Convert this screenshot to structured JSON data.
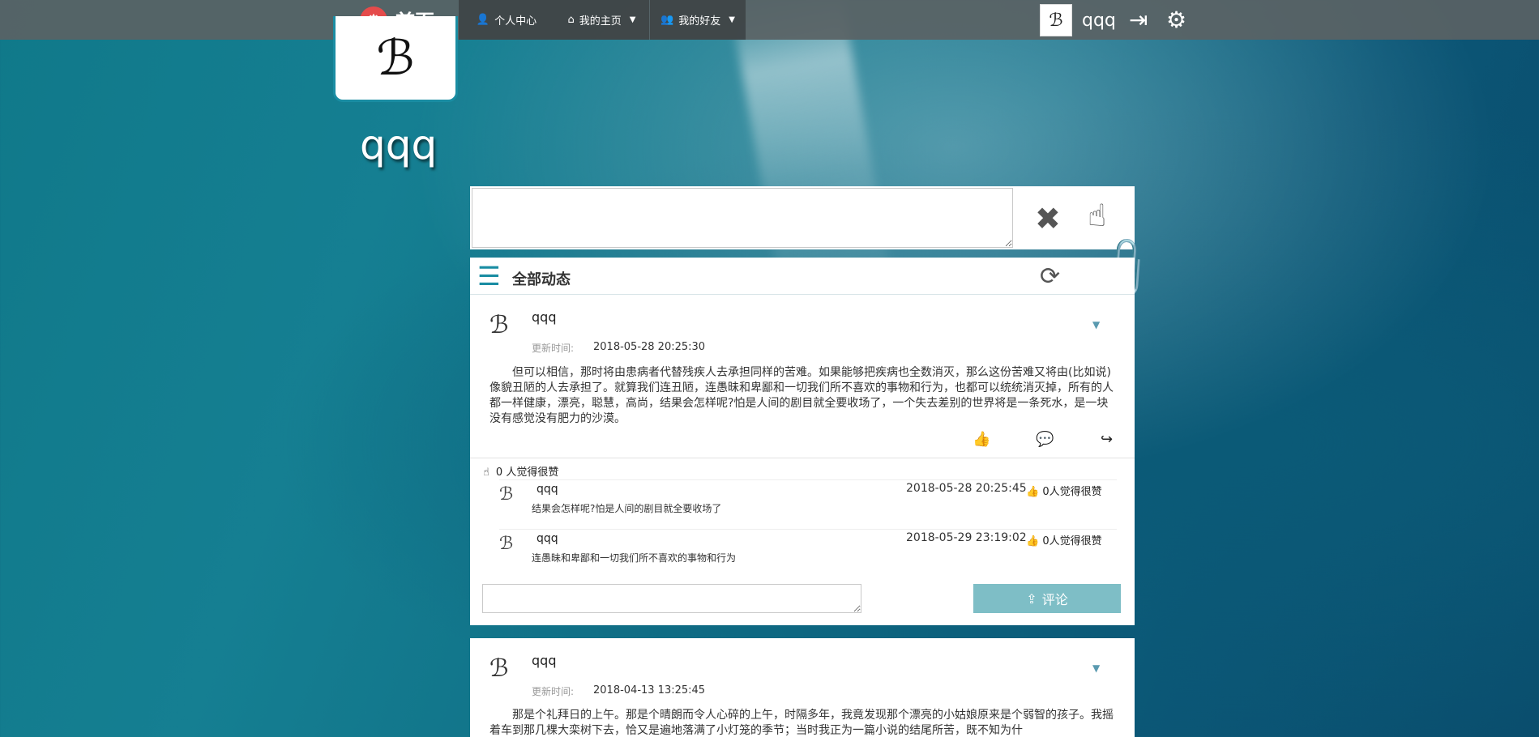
{
  "nav": {
    "brand": "首页",
    "items": [
      {
        "label": "个人中心",
        "icon": "user-icon"
      },
      {
        "label": "我的主页",
        "icon": "home-icon"
      },
      {
        "label": "我的好友",
        "icon": "users-icon"
      }
    ],
    "username": "qqq"
  },
  "profile": {
    "name": "qqq"
  },
  "feed": {
    "title": "全部动态"
  },
  "posts": [
    {
      "user": "qqq",
      "time_label": "更新时间:",
      "time": "2018-05-28 20:25:30",
      "body": "但可以相信，那时将由患病者代替残疾人去承担同样的苦难。如果能够把疾病也全数消灭，那么这份苦难又将由(比如说)像貌丑陋的人去承担了。就算我们连丑陋，连愚昧和卑鄙和一切我们所不喜欢的事物和行为，也都可以统统消灭掉，所有的人都一样健康，漂亮，聪慧，高尚，结果会怎样呢?怕是人间的剧目就全要收场了，一个失去差别的世界将是一条死水，是一块没有感觉没有肥力的沙漠。",
      "likes_text": "0 人觉得很赞",
      "comments": [
        {
          "user": "qqq",
          "time": "2018-05-28 20:25:45",
          "likes": "0人觉得很赞",
          "text": "结果会怎样呢?怕是人间的剧目就全要收场了"
        },
        {
          "user": "qqq",
          "time": "2018-05-29 23:19:02",
          "likes": "0人觉得很赞",
          "text": "连愚昧和卑鄙和一切我们所不喜欢的事物和行为"
        }
      ],
      "comment_button": "评论"
    },
    {
      "user": "qqq",
      "time_label": "更新时间:",
      "time": "2018-04-13 13:25:45",
      "body": "那是个礼拜日的上午。那是个晴朗而令人心碎的上午，时隔多年，我竟发现那个漂亮的小姑娘原来是个弱智的孩子。我摇着车到那几棵大栾树下去，恰又是遍地落满了小灯笼的季节；当时我正为一篇小说的结尾所苦，既不知为什"
    }
  ],
  "colors": {
    "accent": "#1a8da3",
    "comment_button": "#7ebec6",
    "brand_logo": "#e54b4b"
  }
}
